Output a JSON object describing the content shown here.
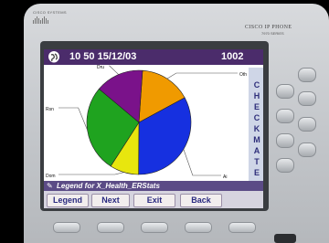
{
  "brand": {
    "left_logo": "CISCO SYSTEMS",
    "name": "CISCO IP PHONE",
    "model": "7970 SERIES"
  },
  "status": {
    "time": "10 50 15/12/03",
    "extension": "1002",
    "globe_icon": "globe-icon"
  },
  "side_label": [
    "C",
    "H",
    "E",
    "C",
    "K",
    "M",
    "A",
    "T",
    "E"
  ],
  "chart_data": {
    "type": "pie",
    "slices": [
      {
        "label": "Oth",
        "value": 16,
        "color": "#f09a00"
      },
      {
        "label": "Ai",
        "value": 33,
        "color": "#1630e0"
      },
      {
        "label": "Dom",
        "value": 9,
        "color": "#e8e60e"
      },
      {
        "label": "Rsn",
        "value": 27,
        "color": "#1fa31f"
      },
      {
        "label": "Dru",
        "value": 15,
        "color": "#7a128a"
      }
    ]
  },
  "prompt": {
    "text": "Legend for X_Health_ERStats",
    "icon": "pencil-icon"
  },
  "softkeys": [
    "Legend",
    "Next",
    "Exit",
    "Back"
  ]
}
